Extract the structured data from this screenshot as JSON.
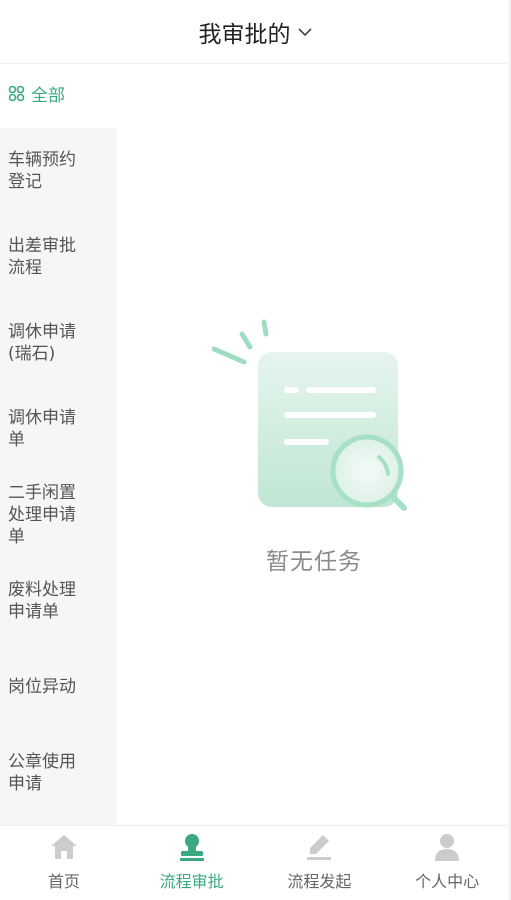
{
  "header": {
    "title": "我审批的",
    "dropdown_icon": "chevron-down-icon"
  },
  "sidebar": {
    "items": [
      {
        "label": "全部",
        "icon": "grid-icon",
        "active": true
      },
      {
        "label": "车辆预约\n登记"
      },
      {
        "label": "出差审批\n流程"
      },
      {
        "label": "调休申请\n(瑞石)"
      },
      {
        "label": "调休申请\n单"
      },
      {
        "label": "二手闲置\n处理申请\n单"
      },
      {
        "label": "废料处理\n申请单"
      },
      {
        "label": "岗位异动"
      },
      {
        "label": "公章使用\n申请"
      }
    ]
  },
  "main": {
    "empty_text": "暂无任务",
    "empty_icon": "empty-document-search-icon"
  },
  "tabbar": {
    "items": [
      {
        "label": "首页",
        "icon": "home-icon",
        "active": false
      },
      {
        "label": "流程审批",
        "icon": "approval-stamp-icon",
        "active": true
      },
      {
        "label": "流程发起",
        "icon": "edit-pen-icon",
        "active": false
      },
      {
        "label": "个人中心",
        "icon": "user-icon",
        "active": false
      }
    ]
  },
  "colors": {
    "accent": "#3aa97f",
    "inactive": "#cccccc",
    "sidebar_bg": "#f6f6f6"
  }
}
